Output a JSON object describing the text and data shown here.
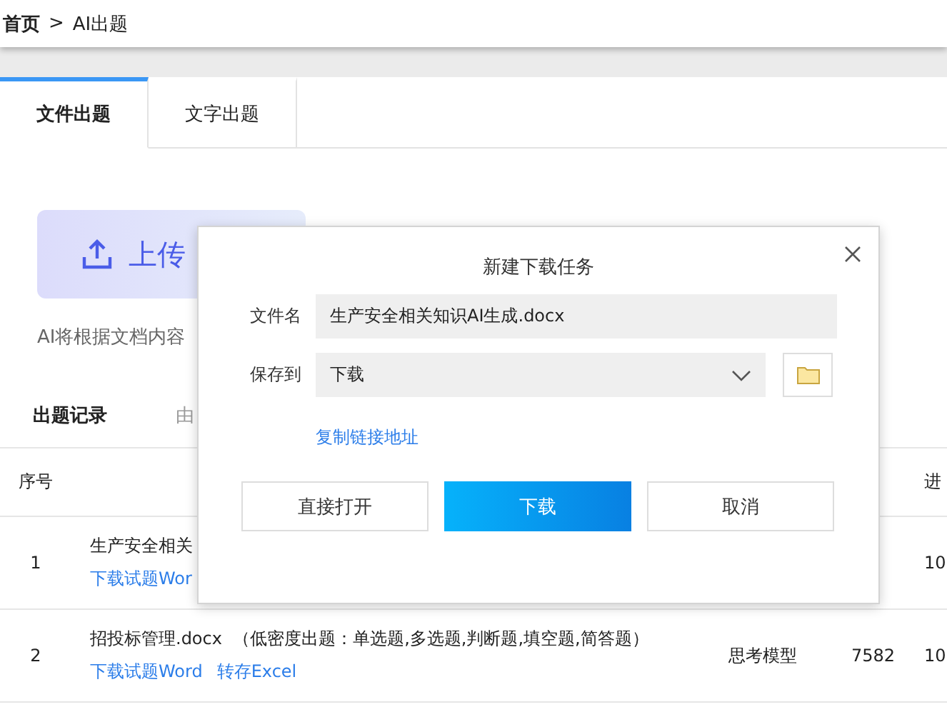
{
  "breadcrumb": {
    "home": "首页",
    "separator": ">",
    "current": "AI出题"
  },
  "tabs": [
    {
      "label": "文件出题",
      "selected": true
    },
    {
      "label": "文字出题",
      "selected": false
    }
  ],
  "upload": {
    "label": "上传"
  },
  "hint": "AI将根据文档内容",
  "records": {
    "title": "出题记录",
    "subtitle": "由"
  },
  "table": {
    "columns": [
      "序号",
      "进"
    ],
    "rows": [
      {
        "index": "1",
        "name": "生产安全相关",
        "links": [
          "下载试题Wor"
        ],
        "progress": "10"
      },
      {
        "index": "2",
        "name": "招投标管理.docx",
        "note": "（低密度出题：单选题,多选题,判断题,填空题,简答题）",
        "links": [
          "下载试题Word",
          "转存Excel"
        ],
        "model": "思考模型",
        "count": "7582",
        "progress": "10"
      }
    ]
  },
  "dialog": {
    "title": "新建下载任务",
    "filename_label": "文件名",
    "filename": "生产安全相关知识AI生成.docx",
    "save_label": "保存到",
    "save_to": "下载",
    "link": "复制链接地址",
    "buttons": [
      {
        "label": "直接打开",
        "kind": "default"
      },
      {
        "label": "下载",
        "kind": "primary"
      },
      {
        "label": "取消",
        "kind": "default"
      }
    ]
  }
}
